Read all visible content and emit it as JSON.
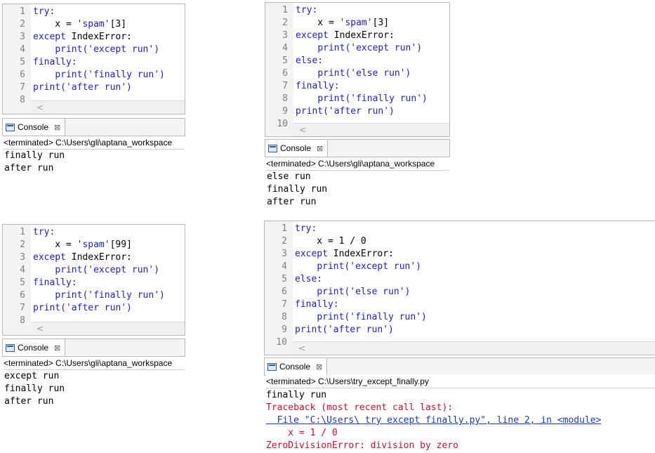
{
  "console_label": "Console",
  "panels": {
    "p1": {
      "lines": [
        {
          "n": "1",
          "segs": [
            [
              "kw",
              "try:"
            ]
          ]
        },
        {
          "n": "2",
          "segs": [
            [
              "plain",
              "    x = "
            ],
            [
              "str",
              "'spam'"
            ],
            [
              "plain",
              "[3]"
            ]
          ]
        },
        {
          "n": "3",
          "segs": [
            [
              "kw",
              "except"
            ],
            [
              "plain",
              " IndexError:"
            ]
          ]
        },
        {
          "n": "4",
          "segs": [
            [
              "plain",
              "    "
            ],
            [
              "kw",
              "print"
            ],
            [
              "str",
              "('except run')"
            ]
          ]
        },
        {
          "n": "5",
          "segs": [
            [
              "kw",
              "finally:"
            ]
          ]
        },
        {
          "n": "6",
          "segs": [
            [
              "plain",
              "    "
            ],
            [
              "kw",
              "print"
            ],
            [
              "str",
              "('finally run')"
            ]
          ]
        },
        {
          "n": "7",
          "segs": [
            [
              "kw",
              "print"
            ],
            [
              "str",
              "('after run')"
            ]
          ]
        },
        {
          "n": "8",
          "segs": []
        }
      ],
      "status": "<terminated> C:\\Users\\gli\\aptana_workspace",
      "output": [
        {
          "cls": "",
          "text": "finally run"
        },
        {
          "cls": "",
          "text": "after run"
        }
      ]
    },
    "p2": {
      "lines": [
        {
          "n": "1",
          "segs": [
            [
              "kw",
              "try:"
            ]
          ]
        },
        {
          "n": "2",
          "segs": [
            [
              "plain",
              "    x = "
            ],
            [
              "str",
              "'spam'"
            ],
            [
              "plain",
              "[3]"
            ]
          ]
        },
        {
          "n": "3",
          "segs": [
            [
              "kw",
              "except"
            ],
            [
              "plain",
              " IndexError:"
            ]
          ]
        },
        {
          "n": "4",
          "segs": [
            [
              "plain",
              "    "
            ],
            [
              "kw",
              "print"
            ],
            [
              "str",
              "('except run')"
            ]
          ]
        },
        {
          "n": "5",
          "segs": [
            [
              "kw",
              "else:"
            ]
          ]
        },
        {
          "n": "6",
          "segs": [
            [
              "plain",
              "    "
            ],
            [
              "kw",
              "print"
            ],
            [
              "str",
              "('else run')"
            ]
          ]
        },
        {
          "n": "7",
          "segs": [
            [
              "kw",
              "finally:"
            ]
          ]
        },
        {
          "n": "8",
          "segs": [
            [
              "plain",
              "    "
            ],
            [
              "kw",
              "print"
            ],
            [
              "str",
              "('finally run')"
            ]
          ]
        },
        {
          "n": "9",
          "segs": [
            [
              "kw",
              "print"
            ],
            [
              "str",
              "('after run')"
            ]
          ]
        },
        {
          "n": "10",
          "segs": []
        }
      ],
      "status": "<terminated> C:\\Users\\gli\\aptana_workspace",
      "output": [
        {
          "cls": "",
          "text": "else run"
        },
        {
          "cls": "",
          "text": "finally run"
        },
        {
          "cls": "",
          "text": "after run"
        }
      ]
    },
    "p3": {
      "lines": [
        {
          "n": "1",
          "segs": [
            [
              "kw",
              "try:"
            ]
          ]
        },
        {
          "n": "2",
          "segs": [
            [
              "plain",
              "    x = "
            ],
            [
              "str",
              "'spam'"
            ],
            [
              "plain",
              "[99]"
            ]
          ]
        },
        {
          "n": "3",
          "segs": [
            [
              "kw",
              "except"
            ],
            [
              "plain",
              " IndexError:"
            ]
          ]
        },
        {
          "n": "4",
          "segs": [
            [
              "plain",
              "    "
            ],
            [
              "kw",
              "print"
            ],
            [
              "str",
              "('except run')"
            ]
          ]
        },
        {
          "n": "5",
          "segs": [
            [
              "kw",
              "finally:"
            ]
          ]
        },
        {
          "n": "6",
          "segs": [
            [
              "plain",
              "    "
            ],
            [
              "kw",
              "print"
            ],
            [
              "str",
              "('finally run')"
            ]
          ]
        },
        {
          "n": "7",
          "segs": [
            [
              "kw",
              "print"
            ],
            [
              "str",
              "('after run')"
            ]
          ]
        },
        {
          "n": "8",
          "segs": []
        }
      ],
      "status": "<terminated> C:\\Users\\gli\\aptana_workspace",
      "output": [
        {
          "cls": "",
          "text": "except run"
        },
        {
          "cls": "",
          "text": "finally run"
        },
        {
          "cls": "",
          "text": "after run"
        }
      ]
    },
    "p4": {
      "lines": [
        {
          "n": "1",
          "segs": [
            [
              "kw",
              "try:"
            ]
          ]
        },
        {
          "n": "2",
          "segs": [
            [
              "plain",
              "    x = 1 / 0"
            ]
          ]
        },
        {
          "n": "3",
          "segs": [
            [
              "kw",
              "except"
            ],
            [
              "plain",
              " IndexError:"
            ]
          ]
        },
        {
          "n": "4",
          "segs": [
            [
              "plain",
              "    "
            ],
            [
              "kw",
              "print"
            ],
            [
              "str",
              "('except run')"
            ]
          ]
        },
        {
          "n": "5",
          "segs": [
            [
              "kw",
              "else:"
            ]
          ]
        },
        {
          "n": "6",
          "segs": [
            [
              "plain",
              "    "
            ],
            [
              "kw",
              "print"
            ],
            [
              "str",
              "('else run')"
            ]
          ]
        },
        {
          "n": "7",
          "segs": [
            [
              "kw",
              "finally:"
            ]
          ]
        },
        {
          "n": "8",
          "segs": [
            [
              "plain",
              "    "
            ],
            [
              "kw",
              "print"
            ],
            [
              "str",
              "('finally run')"
            ]
          ]
        },
        {
          "n": "9",
          "segs": [
            [
              "kw",
              "print"
            ],
            [
              "str",
              "('after run')"
            ]
          ]
        },
        {
          "n": "10",
          "segs": []
        }
      ],
      "status": "<terminated> C:\\Users\\try_except_finally.py",
      "output": [
        {
          "cls": "",
          "text": "finally run"
        },
        {
          "cls": "err",
          "text": "Traceback (most recent call last):"
        },
        {
          "cls": "link",
          "text": "  File \"C:\\Users\\ try except finally.py\", line 2, in <module>"
        },
        {
          "cls": "err",
          "text": "    x = 1 / 0"
        },
        {
          "cls": "err",
          "text": "ZeroDivisionError: division by zero"
        }
      ]
    }
  }
}
